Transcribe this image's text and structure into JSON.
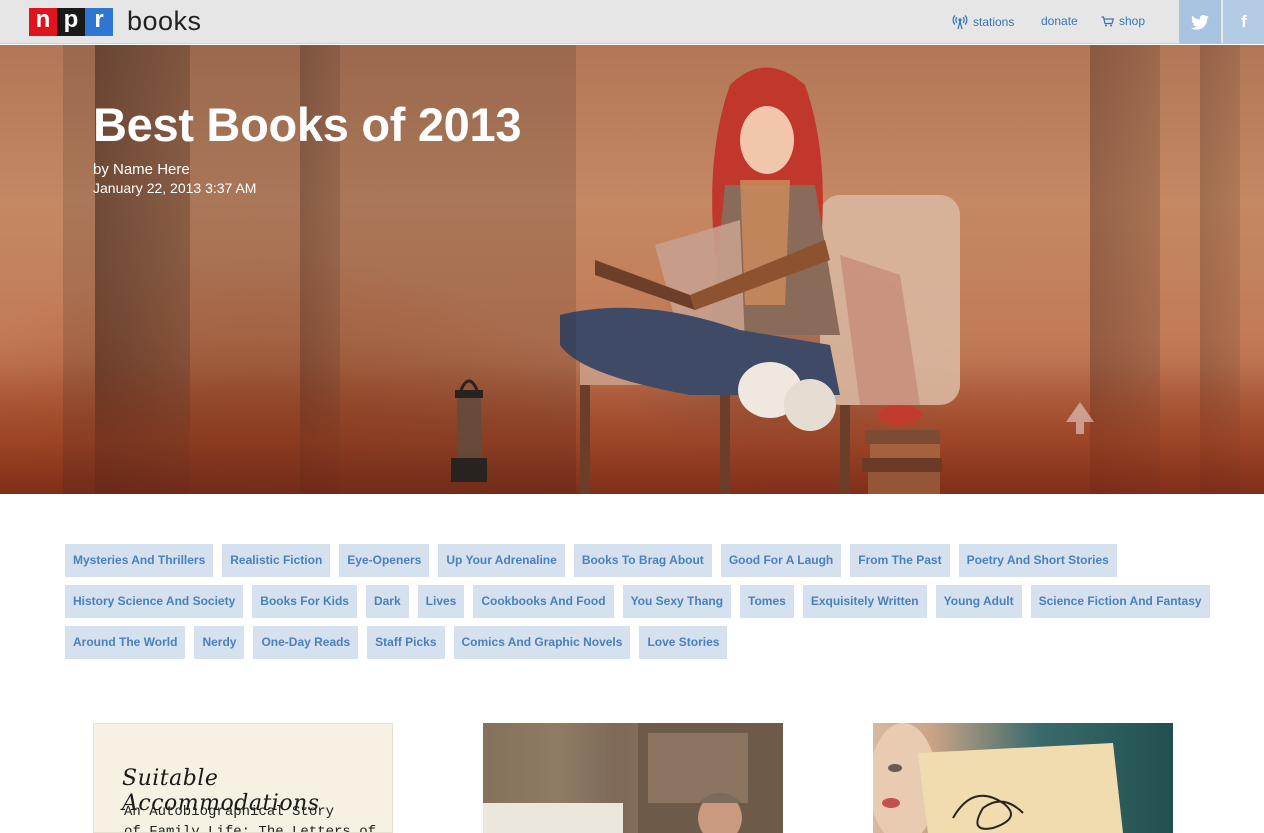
{
  "header": {
    "logo_letters": [
      "n",
      "p",
      "r"
    ],
    "section_name": "books",
    "nav": {
      "stations": "stations",
      "donate": "donate",
      "shop": "shop"
    },
    "social": {
      "twitter_icon": "twitter-icon",
      "facebook_icon": "facebook-icon",
      "facebook_glyph": "f"
    }
  },
  "hero": {
    "title": "Best Books of 2013",
    "byline": "by Name Here",
    "date": "January 22, 2013 3:37 AM"
  },
  "tags": {
    "rows": [
      [
        "Mysteries And Thrillers",
        "Realistic Fiction",
        "Eye-Openers",
        "Up Your Adrenaline",
        "Books To Brag About",
        "Good For A Laugh",
        "From The Past",
        "Poetry And Short Stories"
      ],
      [
        "History Science And Society",
        "Books For Kids",
        "Dark",
        "Lives",
        "Cookbooks And Food",
        "You Sexy Thang",
        "Tomes",
        "Exquisitely Written",
        "Young Adult",
        "Science Fiction And Fantasy"
      ],
      [
        "Around The World",
        "Nerdy",
        "One-Day Reads",
        "Staff Picks",
        "Comics And Graphic Novels",
        "Love Stories"
      ]
    ]
  },
  "books": {
    "cover_1": {
      "title": "Suitable Accommodations",
      "subtitle_line_1": "An Autobiographical Story",
      "subtitle_line_2": "of Family Life: The Letters of"
    }
  },
  "colors": {
    "tag_background": "#d5e1ef",
    "tag_text": "#4a80bd",
    "nav_link": "#3a74b8",
    "npr_red": "#e0141d",
    "npr_black": "#1a1a1a",
    "npr_blue": "#2d77d3"
  }
}
